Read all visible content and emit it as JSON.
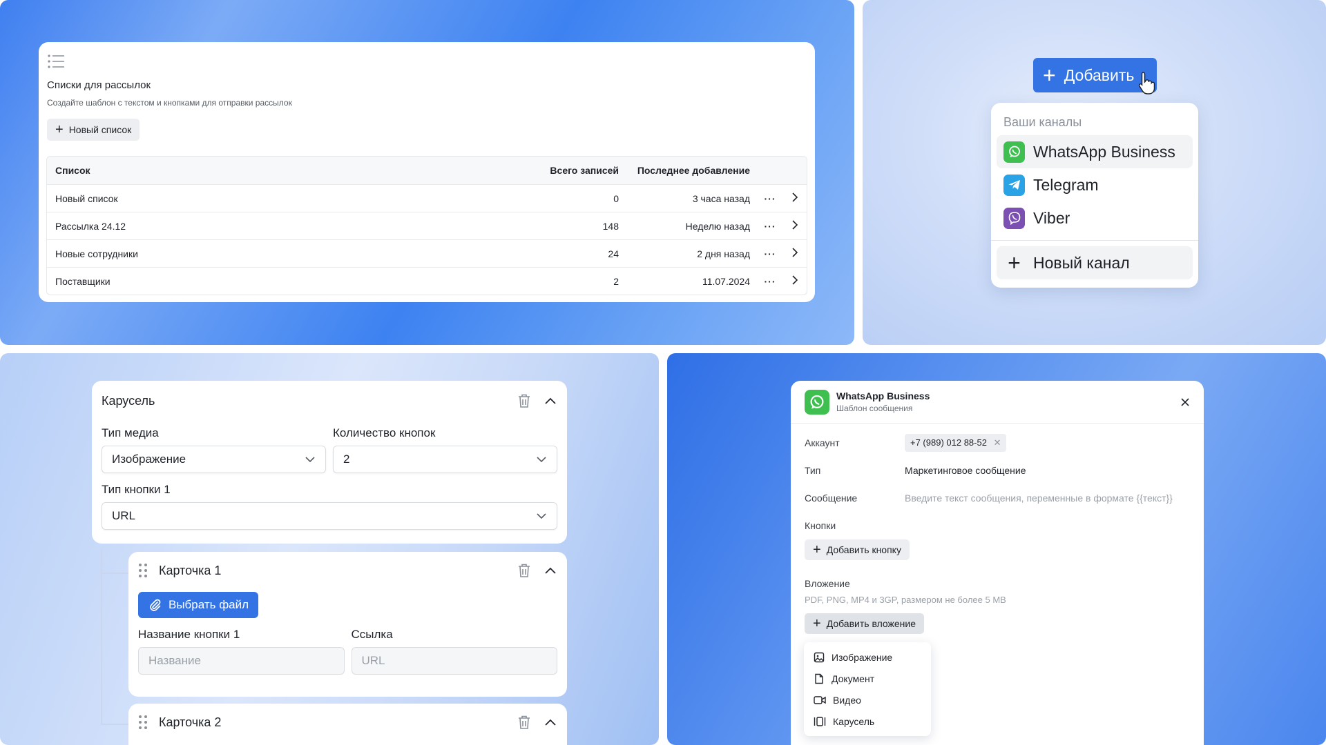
{
  "lists": {
    "title": "Списки для рассылок",
    "subtitle": "Создайте шаблон с текстом и кнопками для отправки рассылок",
    "new_button": "Новый список",
    "columns": [
      "Список",
      "Всего записей",
      "Последнее добавление"
    ],
    "rows": [
      {
        "name": "Новый список",
        "count": "0",
        "last": "3 часа назад"
      },
      {
        "name": "Рассылка 24.12",
        "count": "148",
        "last": "Неделю назад"
      },
      {
        "name": "Новые сотрудники",
        "count": "24",
        "last": "2 дня назад"
      },
      {
        "name": "Поставщики",
        "count": "2",
        "last": "11.07.2024"
      }
    ],
    "more": "···"
  },
  "channels": {
    "add_button": "Добавить",
    "header": "Ваши каналы",
    "items": [
      {
        "label": "WhatsApp Business",
        "color": "#3fbf4f",
        "icon": "whatsapp-icon"
      },
      {
        "label": "Telegram",
        "color": "#2aa3e6",
        "icon": "telegram-icon"
      },
      {
        "label": "Viber",
        "color": "#7c4fb3",
        "icon": "viber-icon"
      }
    ],
    "new_channel": "Новый канал"
  },
  "carousel": {
    "title": "Карусель",
    "media_label": "Тип медиа",
    "media_value": "Изображение",
    "buttons_label": "Количество кнопок",
    "buttons_value": "2",
    "btn_type_label": "Тип кнопки 1",
    "btn_type_value": "URL",
    "card1": {
      "title": "Карточка 1",
      "choose_file": "Выбрать файл",
      "name_label": "Название кнопки 1",
      "name_placeholder": "Название",
      "link_label": "Ссылка",
      "link_placeholder": "URL"
    },
    "card2": {
      "title": "Карточка 2"
    }
  },
  "template": {
    "title": "WhatsApp Business",
    "subtitle": "Шаблон сообщения",
    "account_label": "Аккаунт",
    "account_value": "+7 (989) 012 88-52",
    "type_label": "Тип",
    "type_value": "Маркетинговое сообщение",
    "message_label": "Сообщение",
    "message_placeholder": "Введите текст сообщения, переменные в формате {{текст}}",
    "buttons_label": "Кнопки",
    "add_button": "Добавить кнопку",
    "attach_label": "Вложение",
    "attach_hint": "PDF, PNG, MP4 и 3GP, размером не более 5 MB",
    "add_attachment": "Добавить вложение",
    "menu": [
      "Изображение",
      "Документ",
      "Видео",
      "Карусель"
    ]
  },
  "colors": {
    "accent": "#3473e3",
    "whatsapp": "#3fbf4f"
  }
}
